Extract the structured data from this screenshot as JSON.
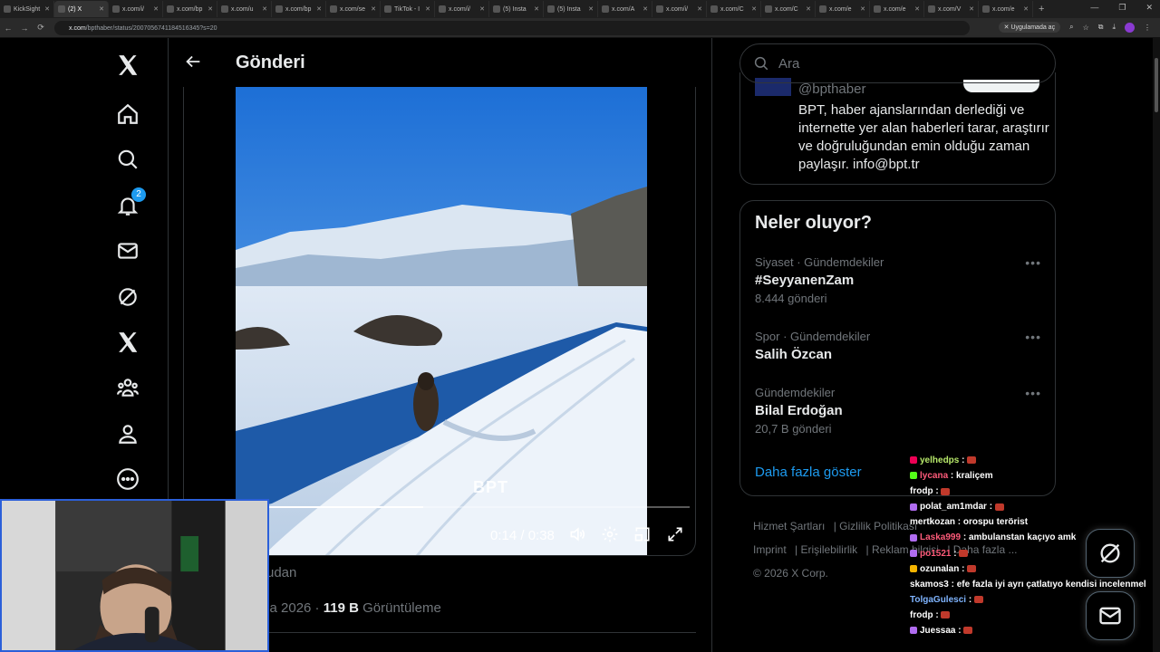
{
  "browser": {
    "tabs": [
      {
        "title": "KickSight"
      },
      {
        "title": "(2) X"
      },
      {
        "title": "x.com/i/"
      },
      {
        "title": "x.com/bp"
      },
      {
        "title": "x.com/u"
      },
      {
        "title": "x.com/bp"
      },
      {
        "title": "x.com/se"
      },
      {
        "title": "TikTok - I"
      },
      {
        "title": "x.com/i/"
      },
      {
        "title": "(5) Insta"
      },
      {
        "title": "(5) Insta"
      },
      {
        "title": "x.com/A"
      },
      {
        "title": "x.com/i/"
      },
      {
        "title": "x.com/C"
      },
      {
        "title": "x.com/C"
      },
      {
        "title": "x.com/e"
      },
      {
        "title": "x.com/e"
      },
      {
        "title": "x.com/V"
      },
      {
        "title": "x.com/e"
      }
    ],
    "url_domain": "x.com",
    "url_path": "/bpthaber/status/2007056741184516345?s=20",
    "open_in_app_label": "Uygulamada aç"
  },
  "nav": {
    "notification_count": "2"
  },
  "header": {
    "title": "Gönderi"
  },
  "video": {
    "watermark": "BPT",
    "time": "0:14 / 0:38",
    "progress": 0.37
  },
  "post_meta": {
    "source_fragment": "udan",
    "date_fragment": "ca 2026",
    "views_count": "119 B",
    "views_label": "Görüntüleme"
  },
  "search": {
    "placeholder": "Ara"
  },
  "profile_card": {
    "handle": "@bpthaber",
    "bio": "BPT, haber ajanslarından derlediği ve internette yer alan haberleri tarar, araştırır ve doğruluğundan emin olduğu zaman paylaşır. info@bpt.tr"
  },
  "trends": {
    "title": "Neler oluyor?",
    "items": [
      {
        "category": "Siyaset · Gündemdekiler",
        "name": "#SeyyanenZam",
        "count": "8.444 gönderi"
      },
      {
        "category": "Spor · Gündemdekiler",
        "name": "Salih Özcan",
        "count": ""
      },
      {
        "category": "Gündemdekiler",
        "name": "Bilal Erdoğan",
        "count": "20,7 B gönderi"
      }
    ],
    "show_more": "Daha fazla göster"
  },
  "footer": {
    "links": [
      "Hizmet Şartları",
      "Gizlilik Politikası",
      "Imprint",
      "Erişilebilirlik",
      "Reklam bilgisi",
      "Daha fazla ..."
    ],
    "copyright": "© 2026 X Corp."
  },
  "chat": {
    "messages": [
      {
        "user": "yelhedps",
        "text": "",
        "color": "#b7e86a",
        "badge": "#e05"
      },
      {
        "user": "lycana",
        "text": "kraliçem",
        "color": "#ff5b7a",
        "badge": "#53fc18"
      },
      {
        "user": "frodp",
        "text": "",
        "color": "#ffffff",
        "badge": ""
      },
      {
        "user": "polat_am1mdar",
        "text": "",
        "color": "#ffffff",
        "badge": "#b06cf0"
      },
      {
        "user": "mertkozan",
        "text": "orospu terörist",
        "color": "#ffffff",
        "badge": ""
      },
      {
        "user": "Laska999",
        "text": "ambulanstan kaçıyo amk",
        "color": "#ff5b7a",
        "badge": "#b06cf0"
      },
      {
        "user": "po1521",
        "text": "",
        "color": "#ff5b7a",
        "badge": "#b06cf0"
      },
      {
        "user": "ozunalan",
        "text": "",
        "color": "#ffffff",
        "badge": "#f5b400"
      },
      {
        "user": "skamos3",
        "text": "efe fazla iyi ayrı çatlatıyo kendisi incelenmeli",
        "color": "#ffffff",
        "badge": ""
      },
      {
        "user": "TolgaGulesci",
        "text": "",
        "color": "#7fb4ff",
        "badge": ""
      },
      {
        "user": "frodp",
        "text": "",
        "color": "#ffffff",
        "badge": ""
      },
      {
        "user": "Juessaa",
        "text": "",
        "color": "#ffffff",
        "badge": "#b06cf0"
      }
    ]
  },
  "colors": {
    "accent": "#1d9bf0",
    "background": "#000000",
    "border": "#2f3336",
    "muted": "#71767b"
  }
}
